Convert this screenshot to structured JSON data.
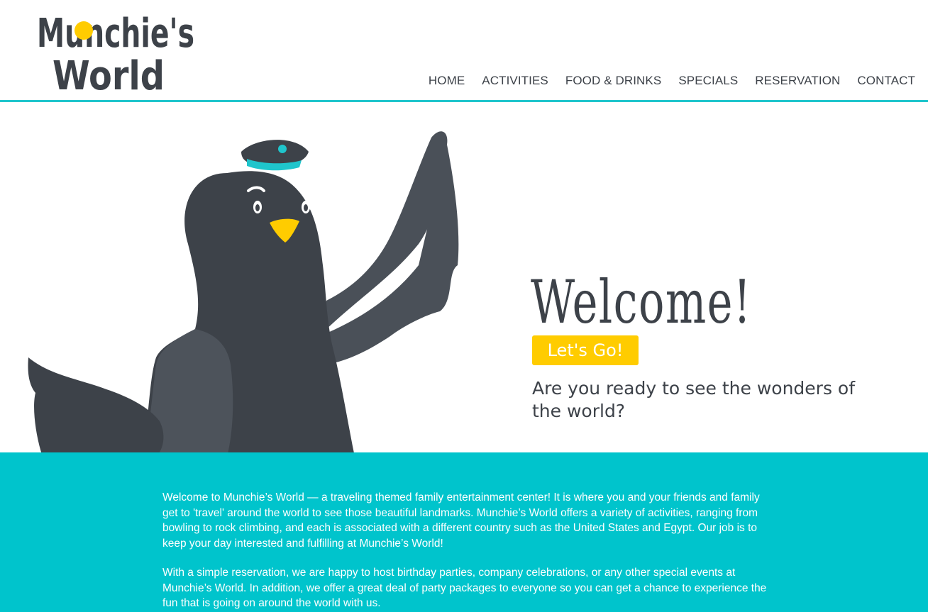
{
  "brand": {
    "logo_line1": "Munchie's",
    "logo_line2": "World",
    "colors": {
      "dark": "#3d4249",
      "yellow": "#ffcc00",
      "teal": "#00c4cc"
    }
  },
  "nav": {
    "items": [
      "HOME",
      "ACTIVITIES",
      "FOOD & DRINKS",
      "SPECIALS",
      "RESERVATION",
      "CONTACT"
    ]
  },
  "hero": {
    "title": "Welcome!",
    "tagline": "Are you ready to see the wonders of the world?",
    "cta_label": "Let's Go!",
    "illustration": "pigeon-mascot-icon"
  },
  "about": {
    "paragraph1": "Welcome to Munchie’s World — a traveling themed family entertainment center! It is where you and your friends and family get to 'travel' around the world to see those beautiful landmarks. Munchie’s World offers a variety of activities, ranging from bowling to rock climbing, and each is associated with a different country such as the United States and Egypt. Our job is to keep your day interested and fulfilling at Munchie’s World!",
    "paragraph2": "With a simple reservation, we are happy to host birthday parties, company celebrations, or any other special events at Munchie’s World. In addition, we offer a great deal of party packages to everyone so you can get a chance to experience the fun that is going on around the world with us."
  }
}
